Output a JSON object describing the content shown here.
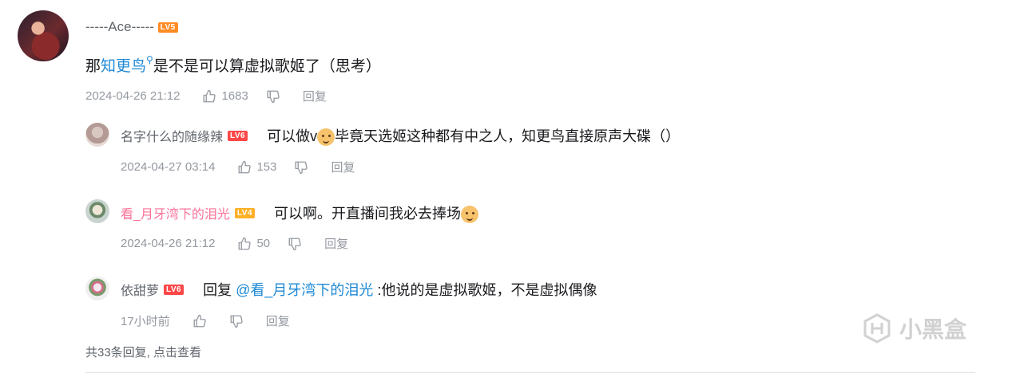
{
  "main_comment": {
    "username": "-----Ace-----",
    "level": "LV5",
    "text_before": "那",
    "link_text": "知更鸟",
    "search_icon": "search-icon",
    "text_after": "是不是可以算虚拟歌姬了（思考）",
    "timestamp": "2024-04-26 21:12",
    "likes": "1683",
    "reply_label": "回复"
  },
  "replies": [
    {
      "username": "名字什么的随缘辣",
      "level": "LV6",
      "text_a": "可以做v",
      "emoji": "doge-emoji",
      "text_b": "毕竟天选姬这种都有中之人，知更鸟直接原声大碟（）",
      "timestamp": "2024-04-27 03:14",
      "likes": "153",
      "reply_label": "回复"
    },
    {
      "username": "看_月牙湾下的泪光",
      "level": "LV4",
      "text_a": "可以啊。开直播间我必去捧场",
      "emoji": "doge-emoji",
      "timestamp": "2024-04-26 21:12",
      "likes": "50",
      "reply_label": "回复"
    },
    {
      "username": "依甜萝",
      "level": "LV6",
      "reply_prefix": "回复 ",
      "mention": "@看_月牙湾下的泪光",
      "text_a": " :他说的是虚拟歌姬，不是虚拟偶像",
      "timestamp": "17小时前",
      "likes": "",
      "reply_label": "回复"
    }
  ],
  "more_replies": "共33条回复, 点击查看",
  "watermark": "小黑盒",
  "colors": {
    "link": "#1e89d6",
    "pink_name": "#fb7299",
    "meta_gray": "#9499a0",
    "lv4": "#ffb027",
    "lv5": "#ff8c24",
    "lv6": "#ff4747"
  }
}
